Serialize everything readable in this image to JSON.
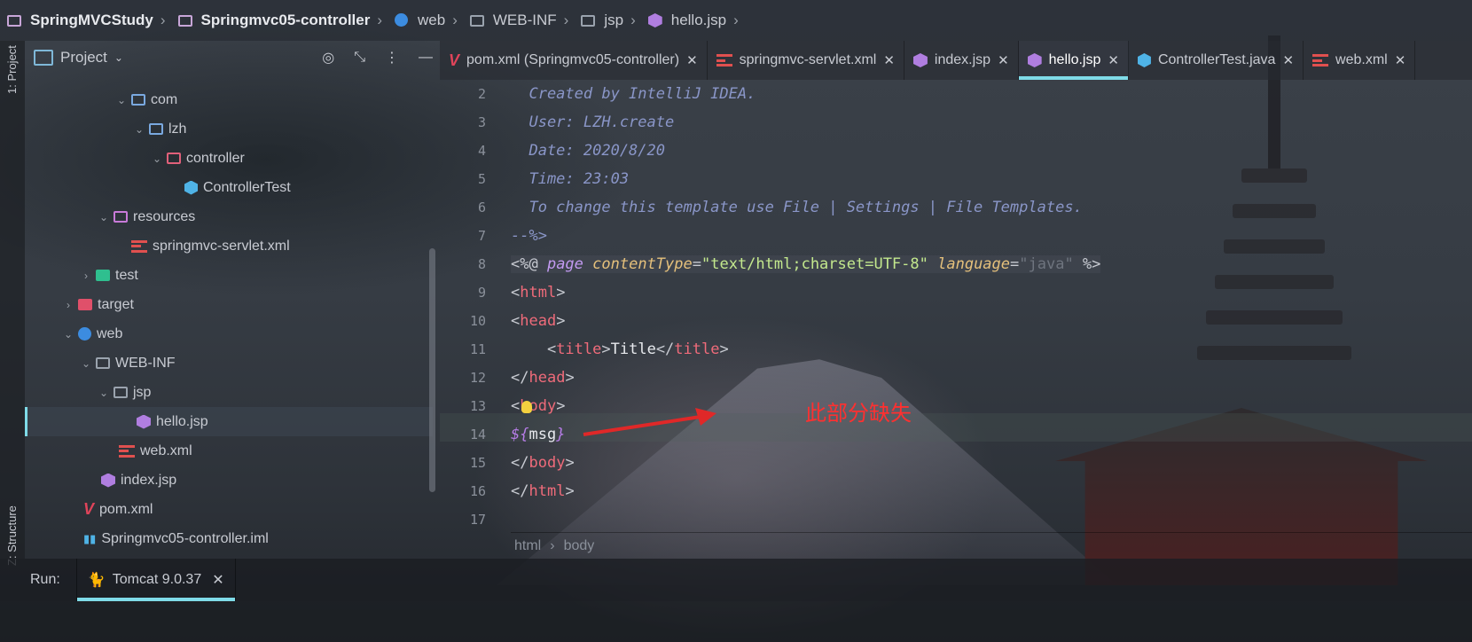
{
  "breadcrumb": [
    {
      "label": "SpringMVCStudy",
      "bold": true,
      "icon": "project-folder-icon"
    },
    {
      "label": "Springmvc05-controller",
      "bold": true,
      "icon": "module-folder-icon"
    },
    {
      "label": "web",
      "bold": false,
      "icon": "web-folder-icon"
    },
    {
      "label": "WEB-INF",
      "bold": false,
      "icon": "folder-icon"
    },
    {
      "label": "jsp",
      "bold": false,
      "icon": "folder-icon"
    },
    {
      "label": "hello.jsp",
      "bold": false,
      "icon": "jsp-file-icon"
    }
  ],
  "side_stripe": {
    "project_label": "1: Project",
    "structure_label": "Z: Structure"
  },
  "project_panel": {
    "title": "Project",
    "tree": [
      {
        "label": "com",
        "icon": "folder",
        "arrow": "down"
      },
      {
        "label": "lzh",
        "icon": "folder",
        "arrow": "down"
      },
      {
        "label": "controller",
        "icon": "package",
        "arrow": "down"
      },
      {
        "label": "ControllerTest",
        "icon": "java",
        "arrow": ""
      },
      {
        "label": "resources",
        "icon": "resources",
        "arrow": "down"
      },
      {
        "label": "springmvc-servlet.xml",
        "icon": "xml",
        "arrow": ""
      },
      {
        "label": "test",
        "icon": "test",
        "arrow": "right"
      },
      {
        "label": "target",
        "icon": "target",
        "arrow": "right"
      },
      {
        "label": "web",
        "icon": "web",
        "arrow": "down"
      },
      {
        "label": "WEB-INF",
        "icon": "folder",
        "arrow": "down"
      },
      {
        "label": "jsp",
        "icon": "folder",
        "arrow": "down"
      },
      {
        "label": "hello.jsp",
        "icon": "jsp",
        "arrow": "",
        "selected": true
      },
      {
        "label": "web.xml",
        "icon": "xml",
        "arrow": ""
      },
      {
        "label": "index.jsp",
        "icon": "jsp",
        "arrow": ""
      },
      {
        "label": "pom.xml",
        "icon": "maven",
        "arrow": ""
      },
      {
        "label": "Springmvc05-controller.iml",
        "icon": "iml",
        "arrow": ""
      }
    ]
  },
  "tabs": [
    {
      "label": "pom.xml (Springmvc05-controller)",
      "icon": "maven",
      "active": false
    },
    {
      "label": "springmvc-servlet.xml",
      "icon": "xml",
      "active": false
    },
    {
      "label": "index.jsp",
      "icon": "jsp",
      "active": false
    },
    {
      "label": "hello.jsp",
      "icon": "jsp",
      "active": true
    },
    {
      "label": "ControllerTest.java",
      "icon": "java",
      "active": false
    },
    {
      "label": "web.xml",
      "icon": "xml",
      "active": false
    }
  ],
  "editor": {
    "line_numbers": [
      "2",
      "3",
      "4",
      "5",
      "6",
      "7",
      "8",
      "9",
      "10",
      "11",
      "12",
      "13",
      "14",
      "15",
      "16",
      "17"
    ],
    "comment_lines": [
      "  Created by IntelliJ IDEA.",
      "  User: LZH.create",
      "  Date: 2020/8/20",
      "  Time: 23:03",
      "  To change this template use File | Settings | File Templates.",
      "--%>"
    ],
    "directive": {
      "open": "<%@ ",
      "keyword": "page",
      "attr1": "contentType",
      "val1": "\"text/html;charset=UTF-8\"",
      "attr2": "language",
      "val2": "\"java\"",
      "close": " %>"
    },
    "tags": {
      "html": "html",
      "head": "head",
      "title": "title",
      "title_text": "Title",
      "body": "body"
    },
    "el_open": "${",
    "el_var": "msg",
    "el_close": "}",
    "breadcrumb": [
      "html",
      "body"
    ]
  },
  "annotation": "此部分缺失",
  "run_bar": {
    "label": "Run:",
    "tab": "Tomcat 9.0.37"
  },
  "colors": {
    "accent": "#7fdbe8",
    "annotation": "#ff3030",
    "tag": "#ef6b7a"
  }
}
